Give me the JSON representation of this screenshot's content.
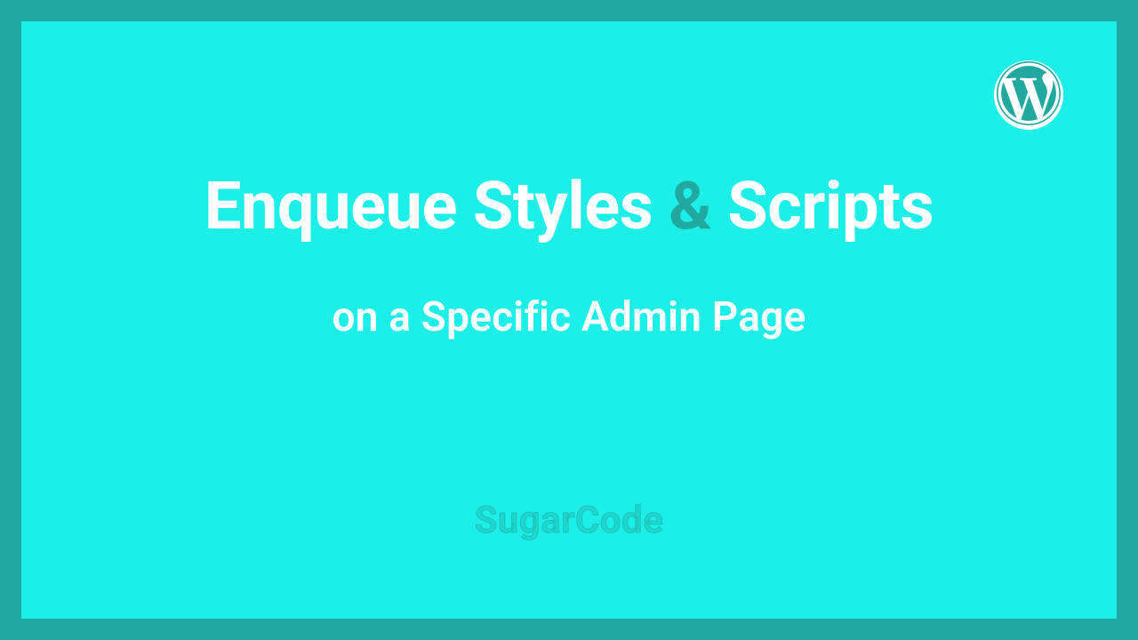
{
  "title": {
    "part1": "Enqueue Styles ",
    "amp": "&",
    "part2": " Scripts"
  },
  "subtitle": "on a Specific Admin Page",
  "brand": "SugarCode",
  "icon_name": "wordpress-icon",
  "colors": {
    "border": "#21a9a0",
    "background": "#1ceee8",
    "text": "#ffffff"
  }
}
